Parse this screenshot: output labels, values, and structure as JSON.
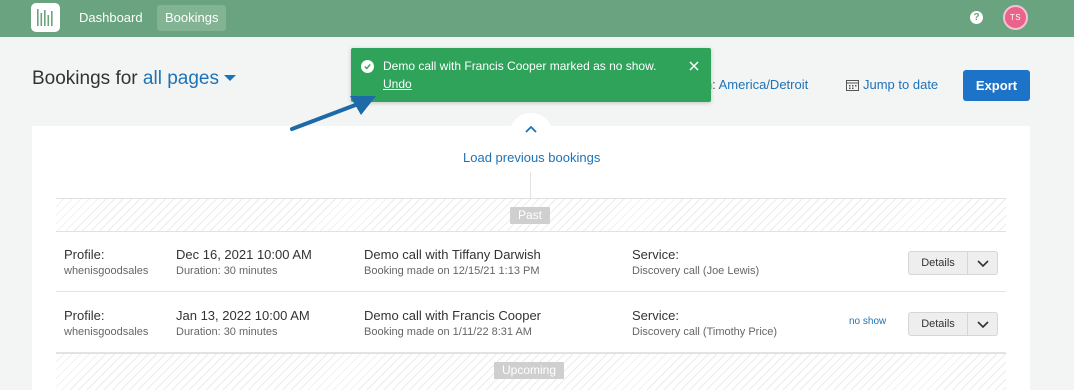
{
  "nav": {
    "items": [
      {
        "label": "Dashboard"
      },
      {
        "label": "Bookings",
        "active": true
      }
    ],
    "help_icon": "help-icon",
    "avatar_initials": "TS"
  },
  "header": {
    "title_prefix": "Bookings for",
    "page_select": "all pages",
    "timezone_prefix": "in:",
    "timezone": "America/Detroit",
    "jump_to_date": "Jump to date",
    "export": "Export"
  },
  "load_previous": "Load previous bookings",
  "dividers": {
    "past": "Past",
    "upcoming": "Upcoming"
  },
  "bookings": [
    {
      "profile_label": "Profile:",
      "profile": "whenisgoodsales",
      "date": "Dec 16, 2021 10:00 AM",
      "duration": "Duration: 30 minutes",
      "title": "Demo call with Tiffany Darwish",
      "booked": "Booking made on 12/15/21 1:13 PM",
      "service_label": "Service:",
      "service": "Discovery call (Joe Lewis)",
      "status": "",
      "details": "Details"
    },
    {
      "profile_label": "Profile:",
      "profile": "whenisgoodsales",
      "date": "Jan 13, 2022 10:00 AM",
      "duration": "Duration: 30 minutes",
      "title": "Demo call with Francis Cooper",
      "booked": "Booking made on 1/11/22 8:31 AM",
      "service_label": "Service:",
      "service": "Discovery call (Timothy Price)",
      "status": "no show",
      "details": "Details"
    }
  ],
  "toast": {
    "message": "Demo call with Francis Cooper marked as no show.",
    "undo": "Undo"
  },
  "colors": {
    "topbar": "#6aa37f",
    "primary": "#1d73c8",
    "toast": "#2fa35a",
    "avatar": "#e9638b",
    "annotation_arrow": "#1c6aa8"
  }
}
